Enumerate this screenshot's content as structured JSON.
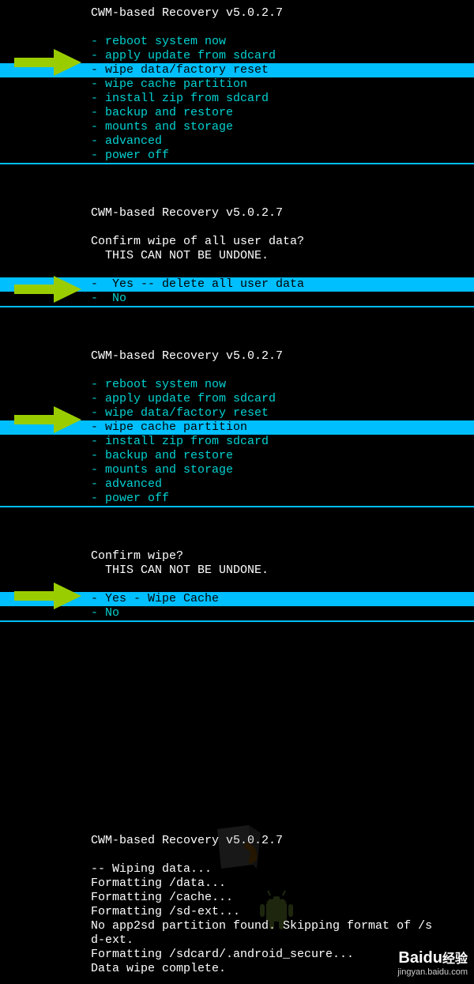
{
  "title": "CWM-based Recovery v5.0.2.7",
  "main_menu": {
    "items": [
      {
        "label": "- reboot system now"
      },
      {
        "label": "- apply update from sdcard"
      },
      {
        "label": "- wipe data/factory reset"
      },
      {
        "label": "- wipe cache partition"
      },
      {
        "label": "- install zip from sdcard"
      },
      {
        "label": "- backup and restore"
      },
      {
        "label": "- mounts and storage"
      },
      {
        "label": "- advanced"
      },
      {
        "label": "- power off"
      }
    ]
  },
  "confirm1": {
    "question": "Confirm wipe of all user data?",
    "warning": "  THIS CAN NOT BE UNDONE.",
    "options": [
      {
        "label": "-  Yes -- delete all user data"
      },
      {
        "label": "-  No"
      }
    ]
  },
  "confirm2": {
    "question": "Confirm wipe?",
    "warning": "  THIS CAN NOT BE UNDONE.",
    "options": [
      {
        "label": "- Yes - Wipe Cache"
      },
      {
        "label": "- No"
      }
    ]
  },
  "log": {
    "lines": [
      "-- Wiping data...",
      "Formatting /data...",
      "Formatting /cache...",
      "Formatting /sd-ext...",
      "No app2sd partition found. Skipping format of /s",
      "d-ext.",
      "Formatting /sdcard/.android_secure...",
      "Data wipe complete."
    ]
  },
  "watermark": {
    "brand": "Baidu",
    "brand_cn": "经验",
    "url": "jingyan.baidu.com"
  }
}
